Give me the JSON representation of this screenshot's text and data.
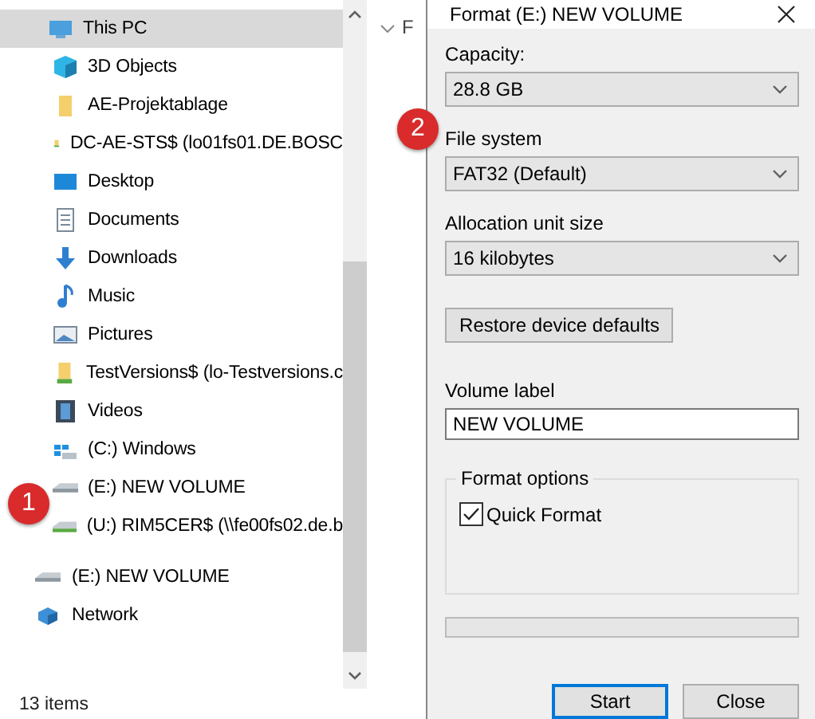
{
  "nav_pane": {
    "items": [
      {
        "label": "This PC",
        "kind": "pc",
        "selected": true,
        "children": [
          {
            "label": "3D Objects",
            "kind": "cube",
            "selected": false
          },
          {
            "label": "AE-Projektablage",
            "kind": "folder",
            "selected": false
          },
          {
            "label": "DC-AE-STS$ (lo01fs01.DE.BOSC",
            "kind": "netfolder",
            "selected": false
          },
          {
            "label": "Desktop",
            "kind": "desktop",
            "selected": false
          },
          {
            "label": "Documents",
            "kind": "documents",
            "selected": false
          },
          {
            "label": "Downloads",
            "kind": "downloads",
            "selected": false
          },
          {
            "label": "Music",
            "kind": "music",
            "selected": false
          },
          {
            "label": "Pictures",
            "kind": "pictures",
            "selected": false
          },
          {
            "label": "TestVersions$ (lo-Testversions.c",
            "kind": "netfolder",
            "selected": false
          },
          {
            "label": "Videos",
            "kind": "videos",
            "selected": false
          },
          {
            "label": "(C:) Windows",
            "kind": "windrive",
            "selected": false
          },
          {
            "label": "(E:) NEW VOLUME",
            "kind": "drive",
            "selected": false
          },
          {
            "label": "(U:) RIM5CER$ (\\\\fe00fs02.de.b",
            "kind": "netdrive",
            "selected": false
          }
        ]
      },
      {
        "label": "(E:) NEW VOLUME",
        "kind": "drive",
        "selected": false
      },
      {
        "label": "Network",
        "kind": "network",
        "selected": false
      }
    ]
  },
  "content_pane": {
    "column_header": "F"
  },
  "status_bar": {
    "item_count": "13 items"
  },
  "dialog": {
    "title": "Format (E:) NEW VOLUME",
    "fields": [
      {
        "kind": "dropdown",
        "label": "Capacity:",
        "value": "28.8 GB"
      },
      {
        "kind": "dropdown",
        "label": "File system",
        "value": "FAT32 (Default)"
      },
      {
        "kind": "dropdown",
        "label": "Allocation unit size",
        "value": "16 kilobytes"
      },
      {
        "kind": "button",
        "label": "Restore device defaults"
      },
      {
        "kind": "text",
        "label": "Volume label",
        "value": "NEW VOLUME"
      }
    ],
    "format_options": {
      "title": "Format options",
      "options": [
        {
          "label": "Quick Format",
          "checked": true
        }
      ]
    },
    "progress": {
      "level": 0
    },
    "buttons": [
      {
        "label": "Start",
        "default": true
      },
      {
        "label": "Close",
        "default": false
      }
    ]
  },
  "annotations": [
    {
      "number": "1"
    },
    {
      "number": "2"
    }
  ]
}
